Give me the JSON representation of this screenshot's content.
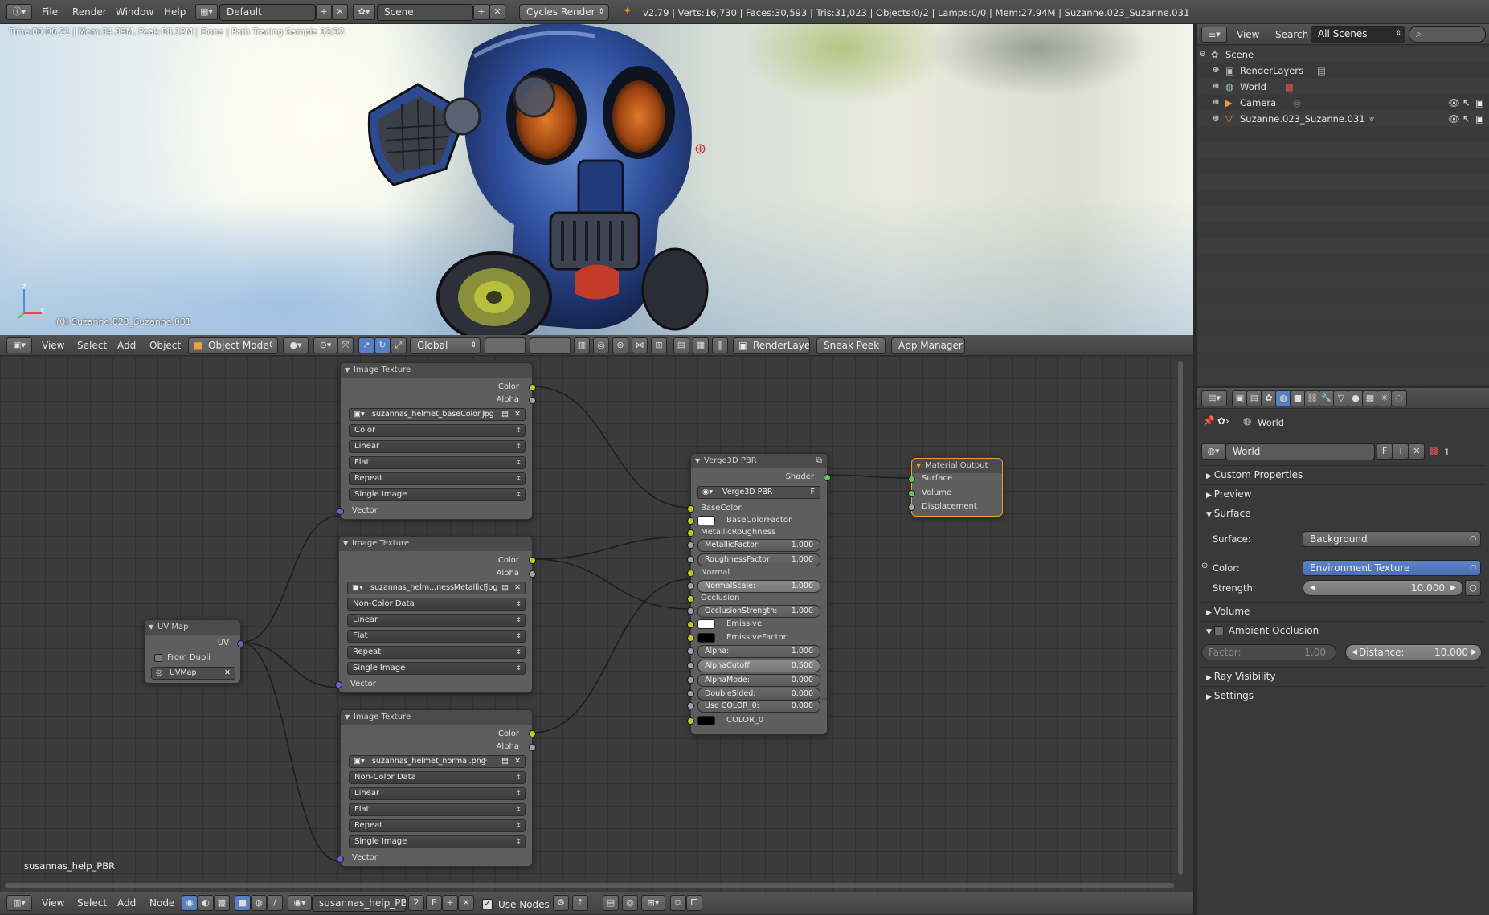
{
  "top_header": {
    "menus": [
      "File",
      "Render",
      "Window",
      "Help"
    ],
    "layout_name": "Default",
    "scene_name": "Scene",
    "engine": "Cycles Render",
    "stats": "v2.79 | Verts:16,730 | Faces:30,593 | Tris:31,023 | Objects:0/2 | Lamps:0/0 | Mem:27.94M | Suzanne.023_Suzanne.031"
  },
  "viewport": {
    "render_info": "Time:00:06.21 | Mem:34.39M, Peak:58.32M | Done | Path Tracing Sample 32/32",
    "object_label": "(0) Suzanne.023_Suzanne.031",
    "axis_x": "x",
    "axis_z": "z"
  },
  "view3d_header": {
    "menus": [
      "View",
      "Select",
      "Add",
      "Object"
    ],
    "mode": "Object Mode",
    "orientation": "Global",
    "renderlayer_btn": "RenderLayer",
    "sneak_peek_btn": "Sneak Peek",
    "app_manager_btn": "App Manager"
  },
  "outliner": {
    "header_menus": [
      "View",
      "Search"
    ],
    "display_mode": "All Scenes",
    "items": [
      {
        "label": "Scene",
        "icon": "scene-icon"
      },
      {
        "label": "RenderLayers",
        "icon": "renderlayers-icon"
      },
      {
        "label": "World",
        "icon": "world-icon"
      },
      {
        "label": "Camera",
        "icon": "camera-icon"
      },
      {
        "label": "Suzanne.023_Suzanne.031",
        "icon": "mesh-icon"
      }
    ]
  },
  "properties": {
    "breadcrumb": "World",
    "world_name": "World",
    "world_fake_user": "F",
    "world_users": "1",
    "panels": {
      "custom_properties": "Custom Properties",
      "preview": "Preview",
      "surface": "Surface",
      "volume": "Volume",
      "ambient_occlusion": "Ambient Occlusion",
      "ray_visibility": "Ray Visibility",
      "settings": "Settings"
    },
    "surface_label": "Surface:",
    "surface_value": "Background",
    "color_label": "Color:",
    "color_value": "Environment Texture",
    "strength_label": "Strength:",
    "strength_value": "10.000",
    "factor_label": "Factor:",
    "factor_value": "1.00",
    "distance_label": "Distance:",
    "distance_value": "10.000"
  },
  "node_editor": {
    "material_name": "susannas_help_PBR",
    "image_tex_1": {
      "title": "Image Texture",
      "out_color": "Color",
      "out_alpha": "Alpha",
      "image": "suzannas_helmet_baseColor.jpg",
      "fake": "F",
      "color_space": "Color",
      "interpolation": "Linear",
      "projection": "Flat",
      "extension": "Repeat",
      "source": "Single Image",
      "in_vector": "Vector"
    },
    "image_tex_2": {
      "title": "Image Texture",
      "out_color": "Color",
      "out_alpha": "Alpha",
      "image": "suzannas_helm...nessMetallic.jpg",
      "fake": "F",
      "color_space": "Non-Color Data",
      "interpolation": "Linear",
      "projection": "Flat",
      "extension": "Repeat",
      "source": "Single Image",
      "in_vector": "Vector"
    },
    "image_tex_3": {
      "title": "Image Texture",
      "out_color": "Color",
      "out_alpha": "Alpha",
      "image": "suzannas_helmet_normal.png",
      "fake": "F",
      "color_space": "Non-Color Data",
      "interpolation": "Linear",
      "projection": "Flat",
      "extension": "Repeat",
      "source": "Single Image",
      "in_vector": "Vector"
    },
    "uv_map": {
      "title": "UV Map",
      "out_uv": "UV",
      "from_dupli": "From Dupli",
      "uvmap": "UVMap"
    },
    "pbr": {
      "title": "Verge3D PBR",
      "out_shader": "Shader",
      "group_name": "Verge3D PBR",
      "fake": "F",
      "base_color": "BaseColor",
      "base_color_factor": "BaseColorFactor",
      "metallic_roughness": "MetallicRoughness",
      "metallic_factor_label": "MetallicFactor:",
      "metallic_factor": "1.000",
      "roughness_factor_label": "RoughnessFactor:",
      "roughness_factor": "1.000",
      "normal": "Normal",
      "normal_scale_label": "NormalScale:",
      "normal_scale": "1.000",
      "occlusion": "Occlusion",
      "occlusion_strength_label": "OcclusionStrength:",
      "occlusion_strength": "1.000",
      "emissive": "Emissive",
      "emissive_factor": "EmissiveFactor",
      "alpha_label": "Alpha:",
      "alpha": "1.000",
      "alpha_cutoff_label": "AlphaCutoff:",
      "alpha_cutoff": "0.500",
      "alpha_mode_label": "AlphaMode:",
      "alpha_mode": "0.000",
      "double_sided_label": "DoubleSided:",
      "double_sided": "0.000",
      "use_color0_label": "Use COLOR_0:",
      "use_color0": "0.000",
      "color0": "COLOR_0"
    },
    "output": {
      "title": "Material Output",
      "surface": "Surface",
      "volume": "Volume",
      "displacement": "Displacement"
    }
  },
  "node_header": {
    "menus": [
      "View",
      "Select",
      "Add",
      "Node"
    ],
    "material": "susannas_help_PBR",
    "users": "2",
    "fake": "F",
    "use_nodes": "Use Nodes"
  }
}
